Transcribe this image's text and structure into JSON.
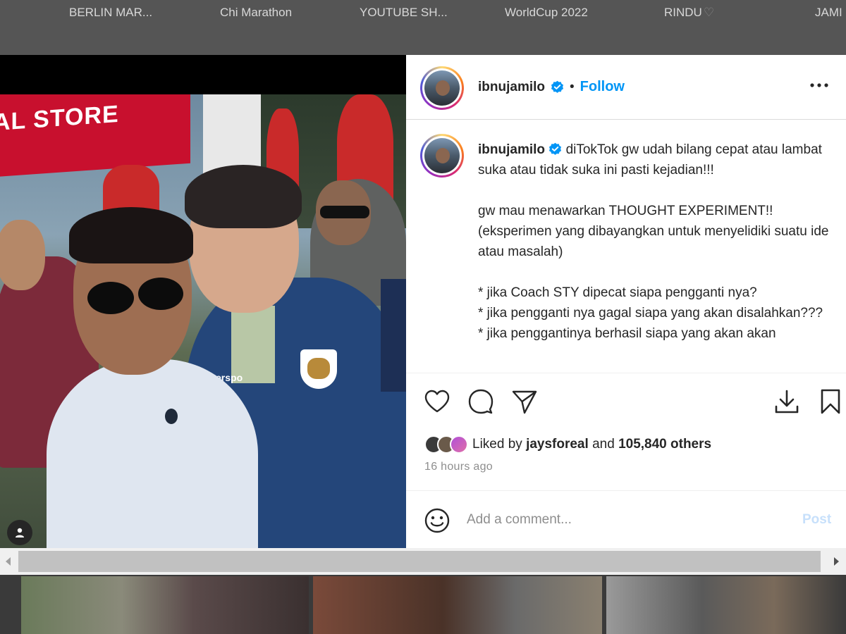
{
  "highlights": [
    {
      "label": "BERLIN MAR..."
    },
    {
      "label": "Chi Marathon"
    },
    {
      "label": "YOUTUBE SH..."
    },
    {
      "label": "WorldCup 2022"
    },
    {
      "label": "RINDU",
      "suffix": "♡"
    },
    {
      "label": "JAMI"
    }
  ],
  "photo": {
    "sign_text": "AL STORE",
    "jacket_brand": "erspo"
  },
  "post": {
    "username": "ibnujamilo",
    "follow_label": "Follow",
    "dot": "•",
    "caption_text": "diTokTok gw udah bilang cepat atau lambat suka atau tidak suka ini pasti kejadian!!!\n\ngw mau menawarkan THOUGHT EXPERIMENT!!\n(eksperimen yang dibayangkan untuk menyelidiki suatu ide atau masalah)\n\n* jika Coach STY dipecat siapa pengganti nya?\n* jika pengganti nya gagal siapa yang akan disalahkan???\n* jika penggantinya berhasil siapa yang akan akan",
    "liked_prefix": "Liked by",
    "liked_user": "jaysforeal",
    "liked_and": "and",
    "liked_count": "105,840 others",
    "time_ago": "16 hours ago",
    "comment_placeholder": "Add a comment...",
    "post_label": "Post"
  },
  "icons": {
    "like": "heart-icon",
    "comment": "comment-bubble-icon",
    "share": "paper-plane-icon",
    "download": "download-icon",
    "save": "bookmark-icon",
    "emoji": "smiley-icon",
    "more": "ellipsis-icon",
    "tag": "person-tag-icon"
  },
  "colors": {
    "accent": "#0095f6",
    "post_disabled": "#c7e0fb",
    "verified": "#0095f6"
  }
}
